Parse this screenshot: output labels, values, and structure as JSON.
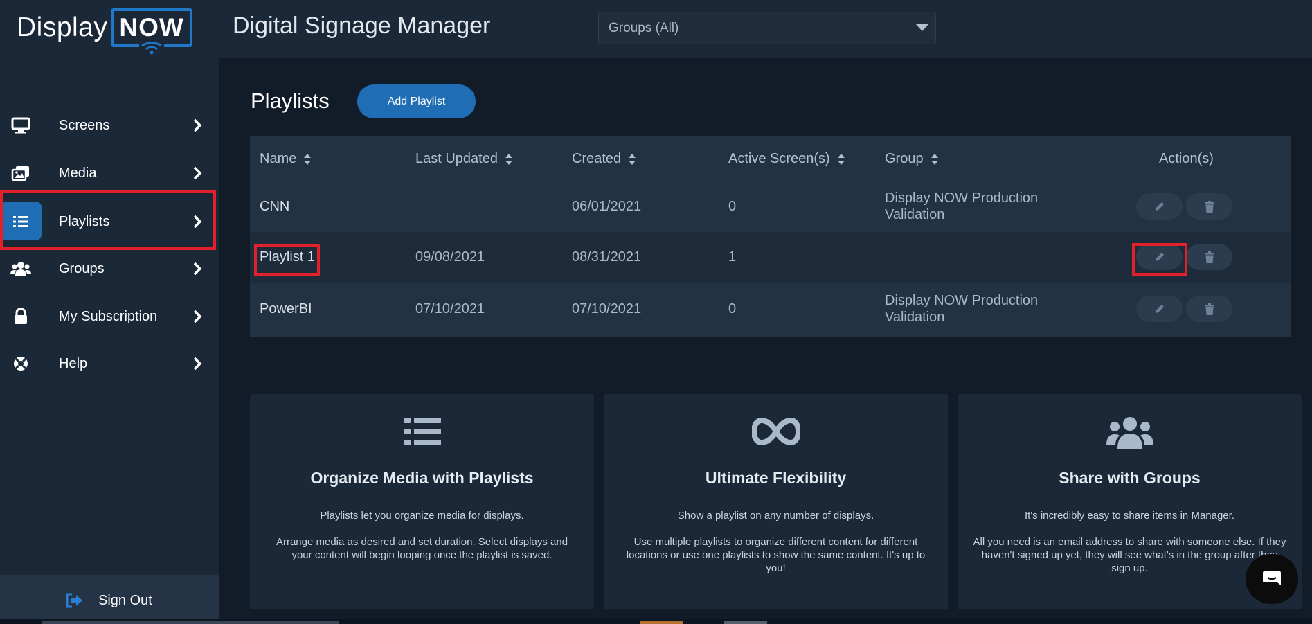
{
  "header": {
    "logo_display": "Display",
    "logo_now": "NOW",
    "app_title": "Digital Signage Manager",
    "group_select_value": "Groups (All)"
  },
  "sidebar": {
    "items": [
      {
        "label": "Screens",
        "icon": "monitor-icon"
      },
      {
        "label": "Media",
        "icon": "media-icon"
      },
      {
        "label": "Playlists",
        "icon": "list-icon",
        "active": true
      },
      {
        "label": "Groups",
        "icon": "users-icon"
      },
      {
        "label": "My Subscription",
        "icon": "lock-icon"
      },
      {
        "label": "Help",
        "icon": "lifebuoy-icon"
      }
    ],
    "sign_out": "Sign Out"
  },
  "main": {
    "title": "Playlists",
    "add_button": "Add Playlist",
    "table": {
      "columns": [
        "Name",
        "Last Updated",
        "Created",
        "Active Screen(s)",
        "Group",
        "Action(s)"
      ],
      "rows": [
        {
          "name": "CNN",
          "last_updated": "",
          "created": "06/01/2021",
          "active_screens": "0",
          "group_line1": "Display NOW Production",
          "group_line2": "Validation"
        },
        {
          "name": "Playlist 1",
          "last_updated": "09/08/2021",
          "created": "08/31/2021",
          "active_screens": "1",
          "group_line1": "",
          "group_line2": ""
        },
        {
          "name": "PowerBI",
          "last_updated": "07/10/2021",
          "created": "07/10/2021",
          "active_screens": "0",
          "group_line1": "Display NOW Production",
          "group_line2": "Validation"
        }
      ]
    }
  },
  "cards": [
    {
      "title": "Organize Media with Playlists",
      "p1": "Playlists let you organize media for displays.",
      "p2": "Arrange media as desired and set duration. Select displays and your content will begin looping once the playlist is saved."
    },
    {
      "title": "Ultimate Flexibility",
      "p1": "Show a playlist on any number of displays.",
      "p2": "Use multiple playlists to organize different content for different locations or use one playlists to show the same content. It's up to you!"
    },
    {
      "title": "Share with Groups",
      "p1": "It's incredibly easy to share items in Manager.",
      "p2": "All you need is an email address to share with someone else. If they haven't signed up yet, they will see what's in the group after they sign up."
    }
  ],
  "colors": {
    "accent": "#1f6eb5",
    "highlight": "#e3212b",
    "sidebar_bg": "#1b2838",
    "page_bg": "#111c28"
  }
}
